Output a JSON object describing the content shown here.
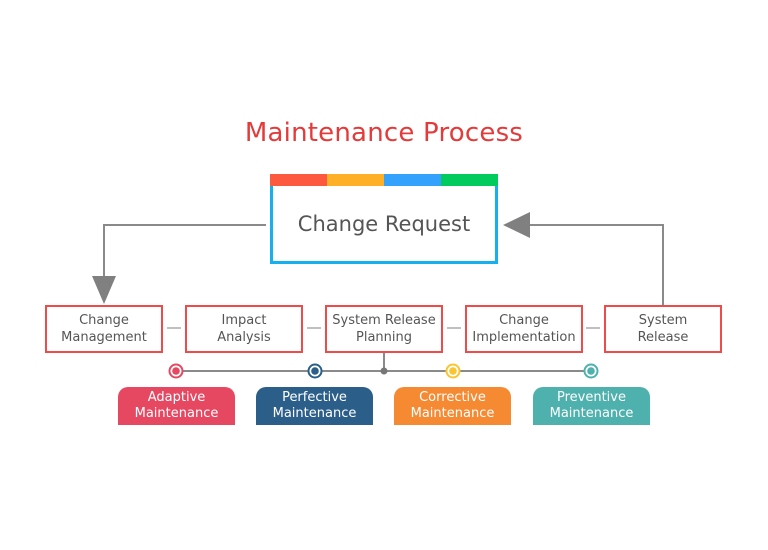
{
  "title": "Maintenance Process",
  "change_request": {
    "label": "Change Request",
    "border_color": "#17b0ee",
    "bar_colors": [
      "#fd5840",
      "#feb128",
      "#34a2fc",
      "#01cb5c"
    ]
  },
  "steps": [
    {
      "line1": "Change",
      "line2": "Management"
    },
    {
      "line1": "Impact",
      "line2": "Analysis"
    },
    {
      "line1": "System Release",
      "line2": "Planning"
    },
    {
      "line1": "Change",
      "line2": "Implementation"
    },
    {
      "line1": "System",
      "line2": "Release"
    }
  ],
  "step_border_color": "#ef4b4b",
  "connector_color": "#8a8a8a",
  "maintenance_types": [
    {
      "line1": "Adaptive",
      "line2": "Maintenance",
      "color": "#e64862"
    },
    {
      "line1": "Perfective",
      "line2": "Maintenance",
      "color": "#2b5f8a"
    },
    {
      "line1": "Corrective",
      "line2": "Maintenance",
      "color": "#f58a33"
    },
    {
      "line1": "Preventive",
      "line2": "Maintenance",
      "color": "#4fb1ae"
    }
  ],
  "marker_colors": [
    "#e64862",
    "#2b5f8a",
    "#fbc531",
    "#4fb1ae"
  ]
}
